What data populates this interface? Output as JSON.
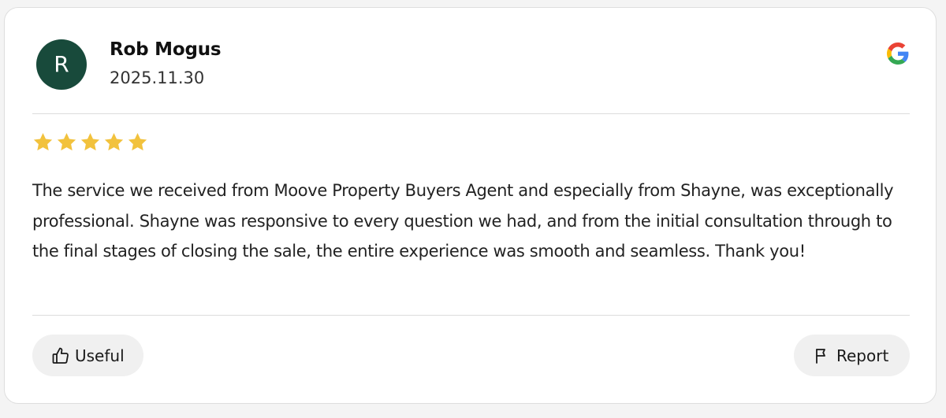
{
  "review": {
    "avatar_initial": "R",
    "author_name": "Rob Mogus",
    "date": "2025.11.30",
    "source_icon": "google-icon",
    "rating": 5,
    "rating_max": 5,
    "text": "The service we received from Moove Property Buyers Agent and especially from Shayne, was exceptionally professional. Shayne was responsive to every question we had, and from the initial consultation through to the final stages of closing the sale, the entire experience was smooth and seamless. Thank you!"
  },
  "actions": {
    "useful_label": "Useful",
    "useful_icon": "thumbs-up-icon",
    "report_label": "Report",
    "report_icon": "flag-icon"
  },
  "colors": {
    "avatar_bg": "#184a3b",
    "star": "#f2c23d",
    "button_bg": "#f0f0f0"
  }
}
